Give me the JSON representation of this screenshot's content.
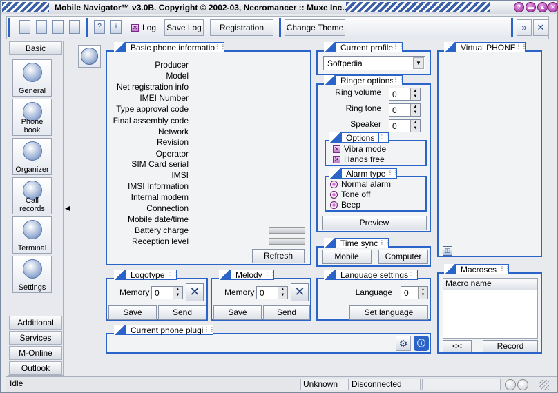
{
  "window": {
    "title": "Mobile Navigator™ v3.0B. Copyright © 2002-03, Necromancer :: Muxe Inc..."
  },
  "toolbar": {
    "log_label": "Log",
    "save_log_label": "Save Log",
    "registration_label": "Registration",
    "change_theme_label": "Change Theme"
  },
  "nav": {
    "basic_tab": "Basic",
    "items": [
      {
        "label": "General",
        "icon": "globe-icon"
      },
      {
        "label": "Phone book",
        "icon": "phone-icon"
      },
      {
        "label": "Organizer",
        "icon": "clock-icon"
      },
      {
        "label": "Call records",
        "icon": "call-records-icon"
      },
      {
        "label": "Terminal",
        "icon": "terminal-icon"
      },
      {
        "label": "Settings",
        "icon": "gears-icon"
      }
    ],
    "bottom_tabs": [
      "Additional",
      "Services",
      "M-Online",
      "Outlook"
    ]
  },
  "basic_info": {
    "title": "Basic phone information",
    "fields": [
      "Producer",
      "Model",
      "Net registration info",
      "IMEI Number",
      "Type approval code",
      "Final assembly code",
      "Network",
      "Revision",
      "Operator",
      "SIM Card serial",
      "IMSI",
      "IMSI Information",
      "Internal modem",
      "Connection",
      "Mobile date/time",
      "Battery charge",
      "Reception level"
    ],
    "refresh_label": "Refresh"
  },
  "current_profile": {
    "title": "Current profile",
    "value": "Softpedia"
  },
  "ringer": {
    "title": "Ringer options",
    "ring_volume_label": "Ring volume",
    "ring_volume": "0",
    "ring_tone_label": "Ring tone",
    "ring_tone": "0",
    "speaker_label": "Speaker",
    "speaker": "0",
    "options_title": "Options",
    "vibra_label": "Vibra mode",
    "hands_free_label": "Hands free",
    "alarm_title": "Alarm type",
    "alarm_options": [
      "Normal alarm",
      "Tone off",
      "Beep"
    ],
    "preview_label": "Preview"
  },
  "time_sync": {
    "title": "Time sync",
    "mobile_label": "Mobile",
    "computer_label": "Computer"
  },
  "virtual_phone": {
    "title": "Virtual PHONE"
  },
  "logotype": {
    "title": "Logotype",
    "memory_label": "Memory",
    "memory": "0",
    "save_label": "Save",
    "send_label": "Send"
  },
  "melody": {
    "title": "Melody",
    "memory_label": "Memory",
    "memory": "0",
    "save_label": "Save",
    "send_label": "Send"
  },
  "language": {
    "title": "Language settings",
    "language_label": "Language",
    "language": "0",
    "set_label": "Set language"
  },
  "macroses": {
    "title": "Macroses",
    "column": "Macro name",
    "back_label": "<<",
    "record_label": "Record"
  },
  "plugin": {
    "title": "Current phone plugin"
  },
  "status": {
    "state": "Idle",
    "unknown": "Unknown",
    "connection": "Disconnected"
  },
  "colors": {
    "accent": "#2a64c8",
    "window_button": "#9a2a9a"
  }
}
